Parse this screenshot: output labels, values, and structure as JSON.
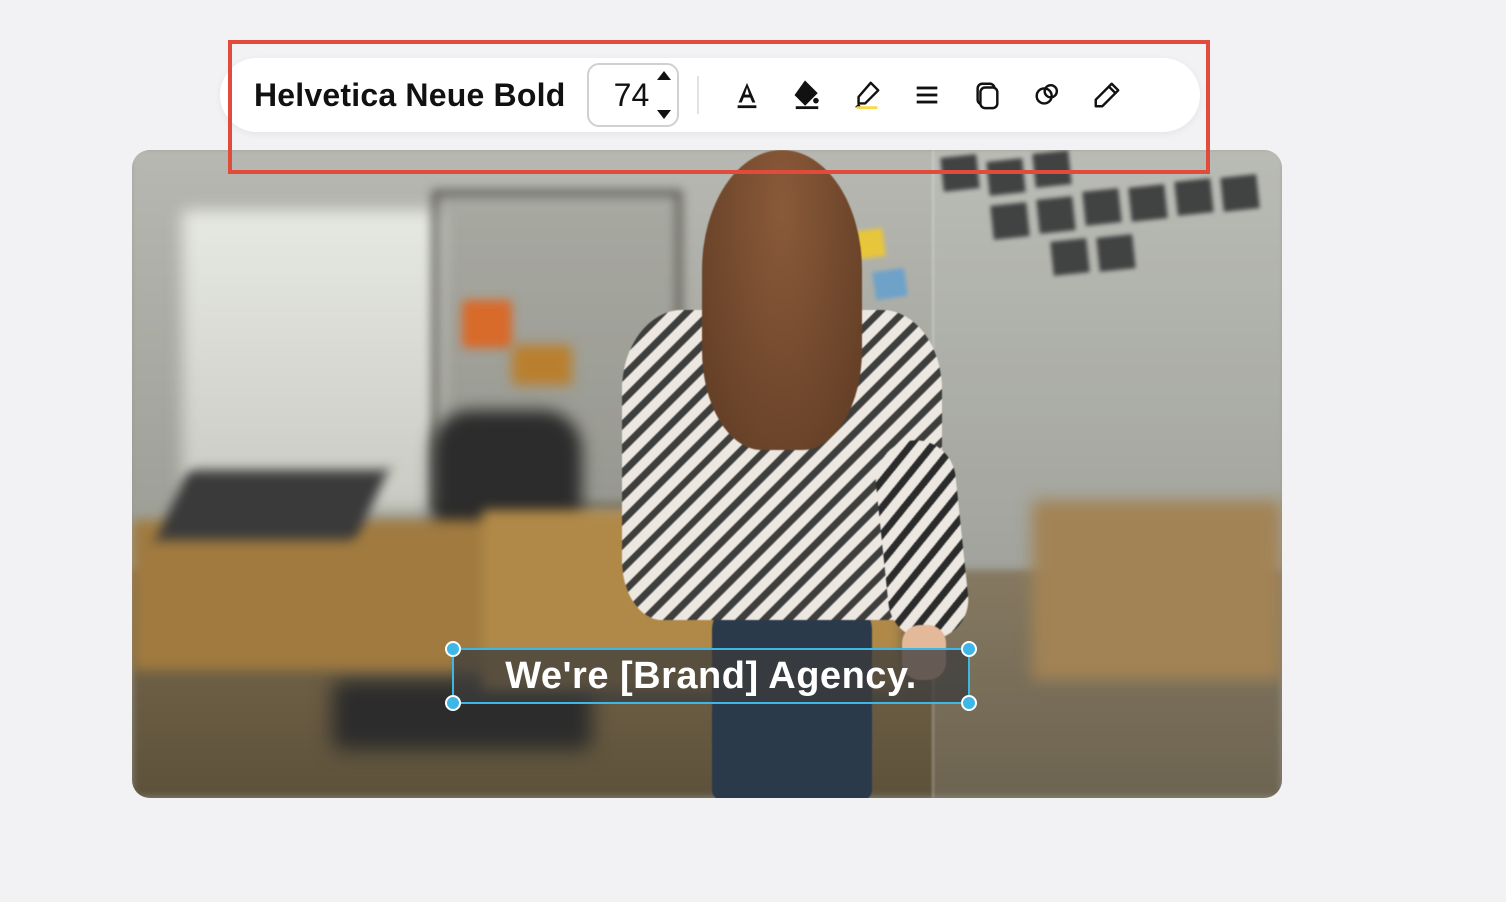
{
  "toolbar": {
    "font_name": "Helvetica Neue Bold",
    "font_size": "74",
    "icons": {
      "text_color": "text-color-icon",
      "fill_color": "fill-color-icon",
      "highlight": "highlight-icon",
      "list": "list-icon",
      "copy_style": "copy-style-icon",
      "effects": "effects-icon",
      "edit": "edit-icon"
    },
    "highlight_color": "#f7d94c"
  },
  "canvas": {
    "selected_text": "We're [Brand] Agency.",
    "selection_color": "#3eb6e6",
    "text_bg": "rgba(60,60,60,0.75)"
  }
}
